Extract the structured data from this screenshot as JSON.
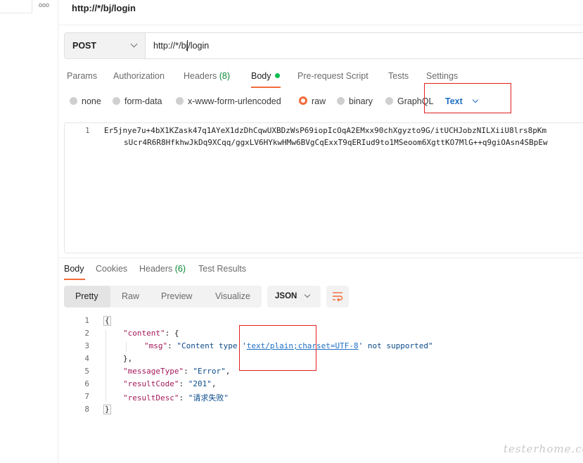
{
  "left_rail": {
    "more_icon": "ooo"
  },
  "request": {
    "title": "http://*/bj/login",
    "method": "POST",
    "url": "http://*/bj/login"
  },
  "request_tabs": [
    {
      "label": "Params",
      "count": ""
    },
    {
      "label": "Authorization",
      "count": ""
    },
    {
      "label": "Headers",
      "count": "(8)"
    },
    {
      "label": "Body",
      "count": ""
    },
    {
      "label": "Pre-request Script",
      "count": ""
    },
    {
      "label": "Tests",
      "count": ""
    },
    {
      "label": "Settings",
      "count": ""
    }
  ],
  "body_types": {
    "options": [
      "none",
      "form-data",
      "x-www-form-urlencoded",
      "raw",
      "binary",
      "GraphQL"
    ],
    "selected": "raw",
    "raw_format": "Text"
  },
  "editor": {
    "line_number": "1",
    "line1": "Er5jnye7u+4bX1KZask47q1AYeX1dzDhCqwUXBDzWsP69iopIcOqA2EMxx90chXgyzto9G/itUCHJobzNILXiiU8lrs8pKm",
    "line2": "sUcr4R6R8HfkhwJkDq9XCqq/ggxLV6HYkwHMw6BVgCqExxT9qERIud9to1MSeoom6XgttKO7MlG++q9giOAsn4SBpEw"
  },
  "response_tabs": [
    {
      "label": "Body",
      "count": ""
    },
    {
      "label": "Cookies",
      "count": ""
    },
    {
      "label": "Headers",
      "count": "(6)"
    },
    {
      "label": "Test Results",
      "count": ""
    }
  ],
  "response_view": {
    "modes": [
      "Pretty",
      "Raw",
      "Preview",
      "Visualize"
    ],
    "selected": "Pretty",
    "format": "JSON",
    "wrap_icon": "wrap-lines-icon"
  },
  "response_body": {
    "line_numbers": [
      "1",
      "2",
      "3",
      "4",
      "5",
      "6",
      "7",
      "8"
    ],
    "open_brace": "{",
    "content_key": "\"content\"",
    "content_open": ": {",
    "msg_key": "\"msg\"",
    "msg_sep": ": ",
    "msg_part1": "\"Content type '",
    "msg_link": "text/plain;charset=UTF-8",
    "msg_part2": "' not supported\"",
    "content_close": "},",
    "messageType_key": "\"messageType\"",
    "messageType_val": "\"Error\"",
    "resultCode_key": "\"resultCode\"",
    "resultCode_val": "\"201\"",
    "resultDesc_key": "\"resultDesc\"",
    "resultDesc_val": "\"请求失败\"",
    "close_brace": "}",
    "colon": ": ",
    "comma": ","
  },
  "watermark": "testerhome.com",
  "colors": {
    "accent": "#f26b3a",
    "link_blue": "#1f6fc5",
    "count_green": "#0a8a34",
    "highlight_red": "#e0201e"
  }
}
